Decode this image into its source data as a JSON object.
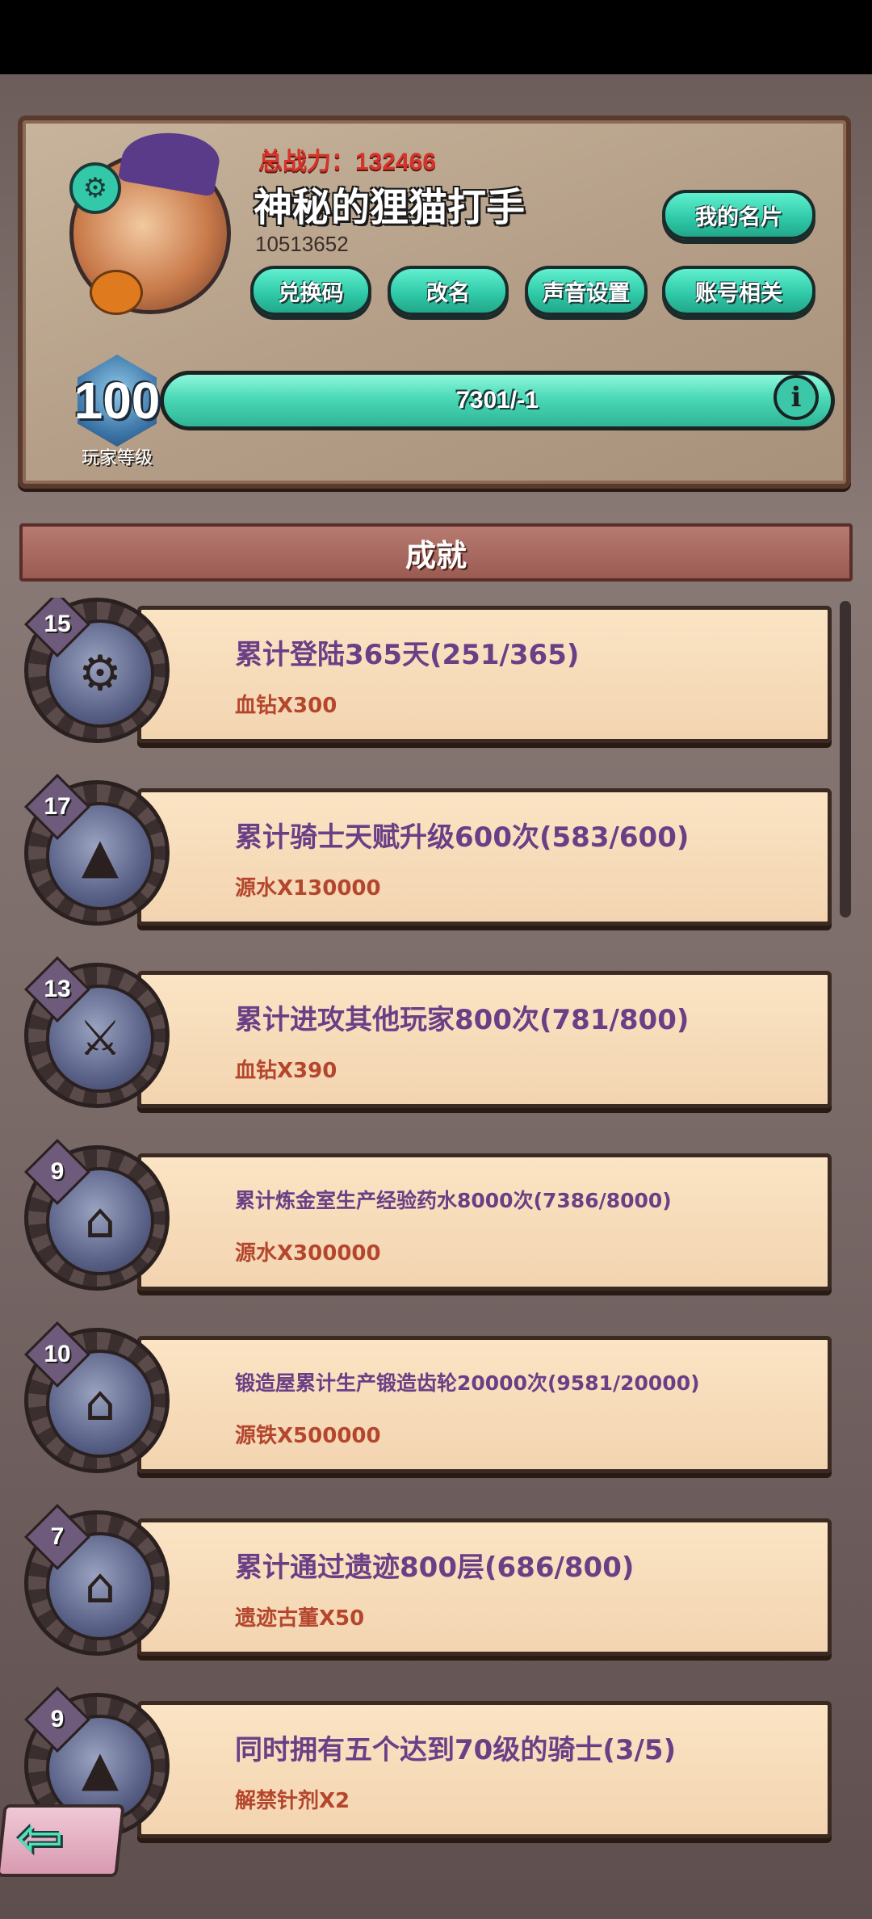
{
  "profile": {
    "power_label": "总战力：",
    "power_value": "132466",
    "player_name": "神秘的狸猫打手",
    "player_id": "10513652",
    "buttons": {
      "my_card": "我的名片",
      "redeem_code": "兑换码",
      "rename": "改名",
      "sound_settings": "声音设置",
      "account": "账号相关"
    },
    "level": "100",
    "level_label": "玩家等级",
    "xp_text": "7301/-1"
  },
  "section_title": "成就",
  "achievements": [
    {
      "badge": "15",
      "title": "累计登陆365天(251/365)",
      "reward": "血钻X300"
    },
    {
      "badge": "17",
      "title": "累计骑士天赋升级600次(583/600)",
      "reward": "源水X130000"
    },
    {
      "badge": "13",
      "title": "累计进攻其他玩家800次(781/800)",
      "reward": "血钻X390"
    },
    {
      "badge": "9",
      "title": "累计炼金室生产经验药水8000次(7386/8000)",
      "reward": "源水X300000"
    },
    {
      "badge": "10",
      "title": "锻造屋累计生产锻造齿轮20000次(9581/20000)",
      "reward": "源铁X500000"
    },
    {
      "badge": "7",
      "title": "累计通过遗迹800层(686/800)",
      "reward": "遗迹古董X50"
    },
    {
      "badge": "9",
      "title": "同时拥有五个达到70级的骑士(3/5)",
      "reward": "解禁针剂X2"
    }
  ],
  "icons": {
    "settings": "gear-icon",
    "info": "info-icon",
    "back": "back-arrow-icon"
  },
  "colors": {
    "accent_teal": "#3cc8a8",
    "title_purple": "#6a3f86",
    "reward_red": "#b5462e",
    "power_red": "#d7332a"
  }
}
